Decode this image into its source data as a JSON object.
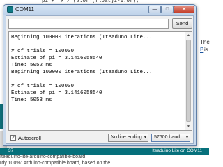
{
  "background": {
    "code_top": "pi += x / (2.0f*(float)i-1.0f);",
    "edge_the": "The",
    "edge_b": "B",
    "edge_is": "is",
    "ide_status": {
      "line_number": "37",
      "board": "Iteaduino Lite on COM11"
    },
    "bottom_line_1": "Iteaduino-lite-arduino-compatible-board",
    "bottom_line_2": "rdy 100%\" Arduino-compatible board, based on the"
  },
  "window": {
    "title": "COM11",
    "controls": {
      "minimize": "—",
      "maximize": "□",
      "close": "✕"
    }
  },
  "send": {
    "input_value": "",
    "button_label": "Send"
  },
  "output": {
    "lines": [
      "Beginning 100000 iterations (Iteaduno Lite...",
      "",
      "# of trials = 100000",
      "Estimate of pi = 3.1416058540",
      "Time: 5052 ms",
      "Beginning 100000 iterations (Iteaduno Lite...",
      "",
      "# of trials = 100000",
      "Estimate of pi = 3.1416058540",
      "Time: 5053 ms"
    ]
  },
  "footer": {
    "autoscroll_label": "Autoscroll",
    "autoscroll_checked": true,
    "checkmark": "✓",
    "line_ending": "No line ending",
    "baud": "57600 baud",
    "caret": "▾"
  },
  "icons": {
    "app_icon": "arduino-app-icon",
    "scroll_up": "▲",
    "scroll_down": "▼"
  },
  "colors": {
    "titlebar": "#c9d9ec",
    "ide_status": "#06707b",
    "close_button": "#c4402c"
  }
}
